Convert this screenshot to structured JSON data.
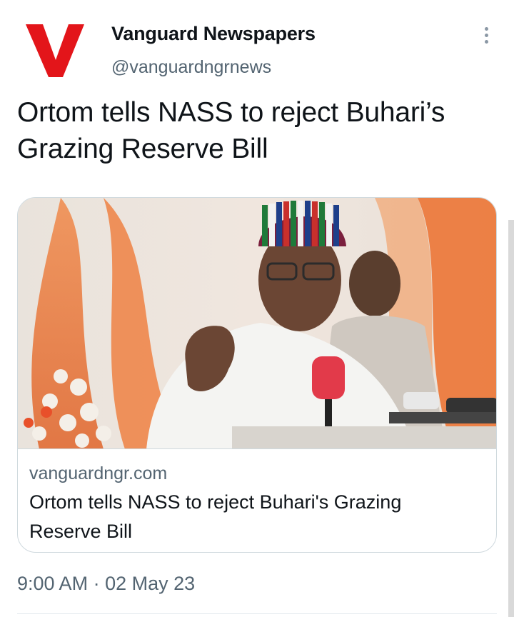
{
  "author": {
    "name": "Vanguard Newspapers",
    "handle": "@vanguardngrnews",
    "logo_letter": "V",
    "logo_color": "#e3151a"
  },
  "tweet": {
    "text": "Ortom tells NASS to reject Buhari’s Grazing Reserve Bill"
  },
  "card": {
    "domain": "vanguardngr.com",
    "title": "Ortom tells NASS to reject Buhari's Grazing Reserve Bill",
    "image_icon": "news-photo"
  },
  "meta": {
    "time": "9:00 AM",
    "separator": "·",
    "date": "02 May 23"
  },
  "icons": {
    "more": "more-vertical-icon"
  }
}
